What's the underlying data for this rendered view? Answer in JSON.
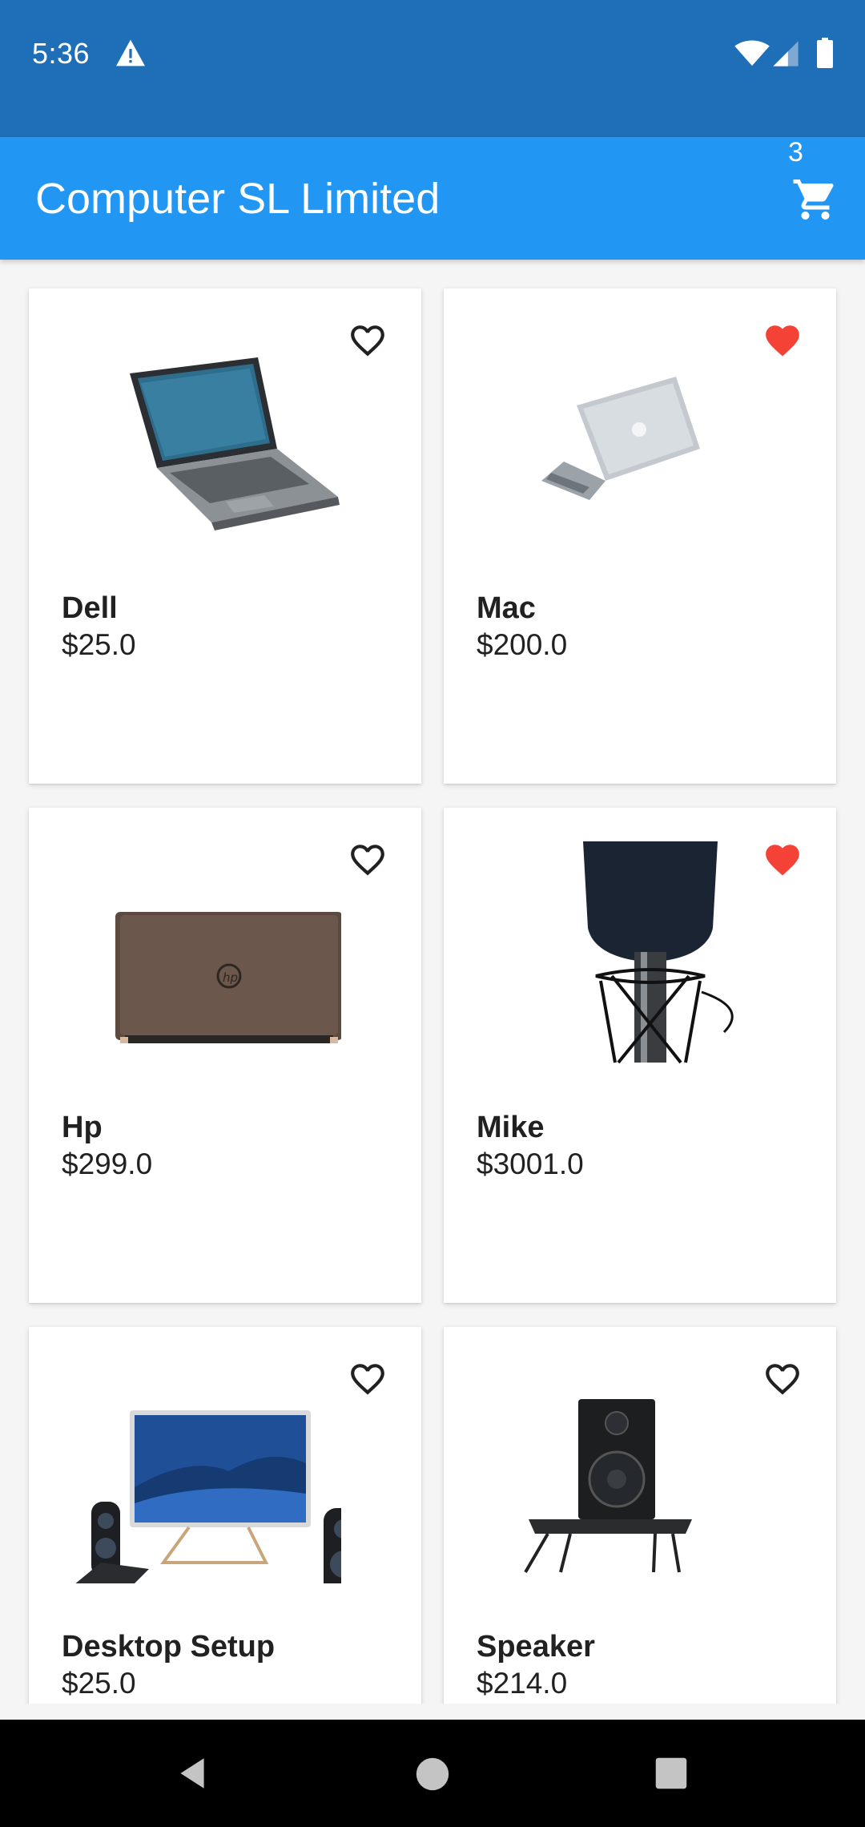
{
  "status_bar": {
    "time": "5:36",
    "icons": [
      "warning-icon",
      "wifi-icon",
      "cell-signal-icon",
      "battery-icon"
    ]
  },
  "app_bar": {
    "title": "Computer SL Limited",
    "cart_count": "3",
    "cart_icon": "shopping-cart-icon"
  },
  "colors": {
    "status_bar": "#1e6fb8",
    "app_bar": "#2196f3",
    "favorite_active": "#f44336",
    "favorite_inactive": "#212121",
    "background": "#f5f5f5"
  },
  "products": [
    {
      "name": "Dell",
      "price": "$25.0",
      "favorite": false,
      "image": "laptop-dell-image"
    },
    {
      "name": "Mac",
      "price": "$200.0",
      "favorite": true,
      "image": "laptop-mac-image"
    },
    {
      "name": "Hp",
      "price": "$299.0",
      "favorite": false,
      "image": "laptop-hp-image"
    },
    {
      "name": "Mike",
      "price": "$3001.0",
      "favorite": true,
      "image": "microphone-image"
    },
    {
      "name": "Desktop Setup",
      "price": "$25.0",
      "favorite": false,
      "image": "desktop-setup-image"
    },
    {
      "name": "Speaker",
      "price": "$214.0",
      "favorite": false,
      "image": "speaker-image"
    }
  ],
  "nav_bar": {
    "buttons": [
      "back-icon",
      "home-icon",
      "recent-apps-icon"
    ]
  }
}
